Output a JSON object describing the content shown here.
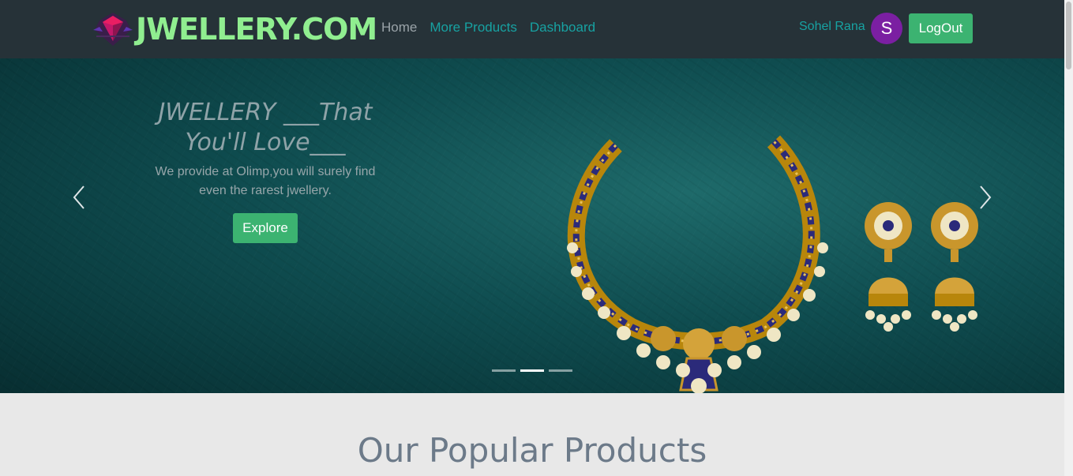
{
  "navbar": {
    "brand": "JWELLERY.COM",
    "links": [
      {
        "label": "Home"
      },
      {
        "label": "More Products"
      },
      {
        "label": "Dashboard"
      }
    ],
    "user_name": "Sohel Rana",
    "avatar_initial": "S",
    "logout_label": "LogOut",
    "colors": {
      "bg": "#263238",
      "brand": "#90ee90",
      "link_active": "#17a2a2",
      "button": "#3cb371",
      "avatar": "#7b1fa2"
    }
  },
  "carousel": {
    "title": "JWELLERY ___That You'll Love___",
    "subtitle": "We provide at Olimp,you will surely find even the rarest jwellery.",
    "cta_label": "Explore",
    "slide_count": 3,
    "active_slide": 2,
    "prev_icon": "chevron-left-icon",
    "next_icon": "chevron-right-icon"
  },
  "section": {
    "title": "Our Popular Products"
  }
}
